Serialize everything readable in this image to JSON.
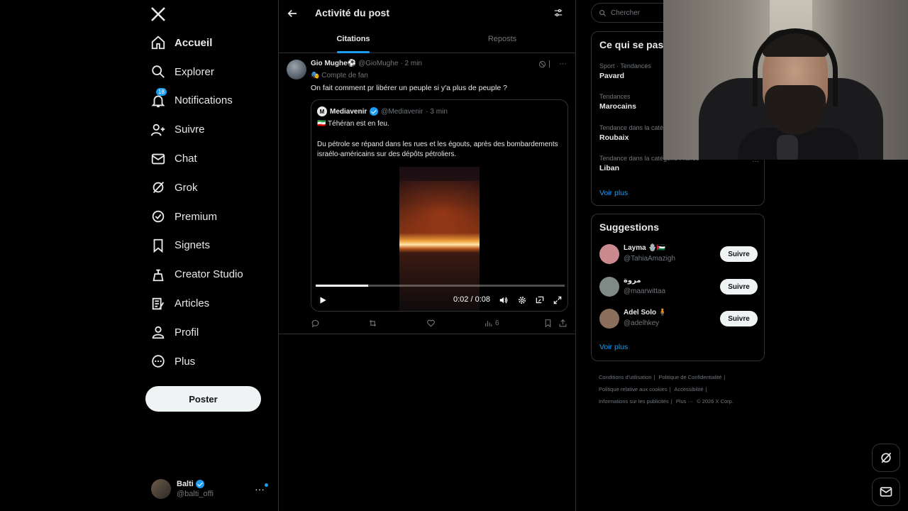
{
  "nav": {
    "items": [
      {
        "label": "Accueil",
        "icon": "home-icon"
      },
      {
        "label": "Explorer",
        "icon": "search-icon"
      },
      {
        "label": "Notifications",
        "icon": "bell-icon",
        "badge": "18"
      },
      {
        "label": "Suivre",
        "icon": "follow-icon"
      },
      {
        "label": "Chat",
        "icon": "mail-icon"
      },
      {
        "label": "Grok",
        "icon": "grok-icon"
      },
      {
        "label": "Premium",
        "icon": "premium-icon"
      },
      {
        "label": "Signets",
        "icon": "bookmark-icon"
      },
      {
        "label": "Creator Studio",
        "icon": "creator-icon"
      },
      {
        "label": "Articles",
        "icon": "articles-icon"
      },
      {
        "label": "Profil",
        "icon": "person-icon"
      },
      {
        "label": "Plus",
        "icon": "more-circle-icon"
      }
    ],
    "post_button": "Poster",
    "account": {
      "name": "Balti",
      "handle": "@balti_offi",
      "more": "···"
    }
  },
  "header": {
    "title": "Activité du post",
    "tabs": [
      {
        "label": "Citations",
        "active": true
      },
      {
        "label": "Reposts",
        "active": false
      }
    ]
  },
  "post": {
    "author": "Gio Mughe⚽",
    "handle": "@GioMughe",
    "time": "· 2 min",
    "badge_label": "🎭 Compte de fan",
    "text": "On fait comment pr libérer un peuple si y'a plus de peuple ?",
    "top_icon_text": "|",
    "quote": {
      "avatar_letter": "M",
      "author": "Mediavenir",
      "handle": "@Mediavenir",
      "time": "· 3 min",
      "line1": "🇮🇷 Téhéran est en feu.",
      "line2": "Du pétrole se répand dans les rues et les égouts, après des bombardements israélo-américains sur des dépôts pétroliers.",
      "video": {
        "time": "0:02 / 0:08",
        "progress": 0.21
      }
    },
    "views": "6"
  },
  "search": {
    "placeholder": "Chercher"
  },
  "trends": {
    "title": "Ce qui se pas",
    "items": [
      {
        "context": "Sport · Tendances",
        "title": "Pavard"
      },
      {
        "context": "Tendances",
        "title": "Marocains"
      },
      {
        "context": "Tendance dans la caté",
        "title": "Roubaix"
      },
      {
        "context": "Tendance dans la catégorie France",
        "title": "Liban"
      }
    ],
    "see_more": "Voir plus"
  },
  "suggestions": {
    "title": "Suggestions",
    "users": [
      {
        "name": "Layma 🪬🇵🇸",
        "handle": "@TahiaAmazigh",
        "button": "Suivre",
        "avatar_color": "#c98a8f"
      },
      {
        "name": "مروة",
        "handle": "@maarwittaa",
        "button": "Suivre",
        "avatar_color": "#7f8a86"
      },
      {
        "name": "Adel Solo 🧍",
        "handle": "@adelhkey",
        "button": "Suivre",
        "avatar_color": "#8a6f5d"
      }
    ],
    "see_more": "Voir plus"
  },
  "footer": {
    "links": [
      "Conditions d'utilisation",
      "|",
      "Politique de Confidentialité",
      "|",
      "Politique relative aux cookies",
      "|",
      "Accessibilité",
      "|",
      "Informations sur les publicités",
      "|",
      "Plus ···",
      "© 2026 X Corp."
    ]
  },
  "colors": {
    "accent": "#1d9bf0",
    "background": "#000000",
    "muted": "#71767b",
    "border": "#2f3336"
  }
}
